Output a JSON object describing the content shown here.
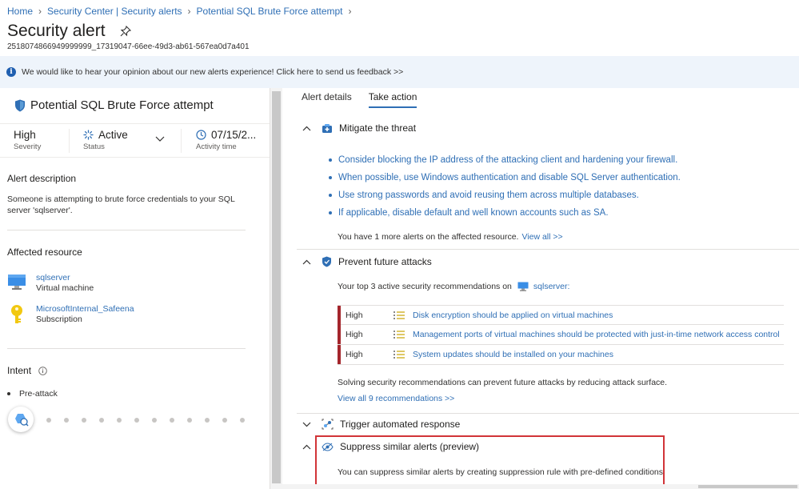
{
  "breadcrumb": [
    "Home",
    "Security Center | Security alerts",
    "Potential SQL Brute Force attempt"
  ],
  "page": {
    "title": "Security alert",
    "alert_id": "2518074866949999999_17319047-66ee-49d3-ab61-567ea0d7a401"
  },
  "banner": {
    "text": "We would like to hear your opinion about our new alerts experience! Click here to send us feedback >>"
  },
  "left": {
    "alert_name": "Potential SQL Brute Force attempt",
    "severity": {
      "value": "High",
      "label": "Severity"
    },
    "status": {
      "value": "Active",
      "label": "Status"
    },
    "activity": {
      "value": "07/15/2...",
      "label": "Activity time"
    },
    "description_heading": "Alert description",
    "description": "Someone is attempting to brute force credentials to your SQL server 'sqlserver'.",
    "affected_heading": "Affected resource",
    "resources": [
      {
        "name": "sqlserver",
        "type": "Virtual machine",
        "icon": "monitor-icon"
      },
      {
        "name": "MicrosoftInternal_Safeena",
        "type": "Subscription",
        "icon": "key-icon"
      }
    ],
    "intent_heading": "Intent",
    "intent_value": "Pre-attack"
  },
  "right": {
    "tabs": [
      "Alert details",
      "Take action"
    ],
    "active_tab": "Take action",
    "mitigate": {
      "title": "Mitigate the threat",
      "items": [
        "Consider blocking the IP address of the attacking client and hardening your firewall.",
        "When possible, use Windows authentication and disable SQL Server authentication.",
        "Use strong passwords and avoid reusing them across multiple databases.",
        "If applicable, disable default and well known accounts such as SA."
      ],
      "more_text": "You have 1 more alerts on the affected resource.",
      "view_all": "View all >>"
    },
    "prevent": {
      "title": "Prevent future attacks",
      "intro": "Your top 3 active security recommendations on",
      "resource": "sqlserver:",
      "recommendations": [
        {
          "severity": "High",
          "text": "Disk encryption should be applied on virtual machines"
        },
        {
          "severity": "High",
          "text": "Management ports of virtual machines should be protected with just-in-time network access control"
        },
        {
          "severity": "High",
          "text": "System updates should be installed on your machines"
        }
      ],
      "footer": "Solving security recommendations can prevent future attacks by reducing attack surface.",
      "view_all": "View all 9 recommendations >>"
    },
    "trigger": {
      "title": "Trigger automated response"
    },
    "suppress": {
      "title": "Suppress similar alerts (preview)",
      "text": "You can suppress similar alerts by creating suppression rule with pre-defined conditions."
    }
  },
  "colors": {
    "link": "#2f6fb5",
    "high_severity": "#a4262c",
    "highlight": "#d13438"
  }
}
